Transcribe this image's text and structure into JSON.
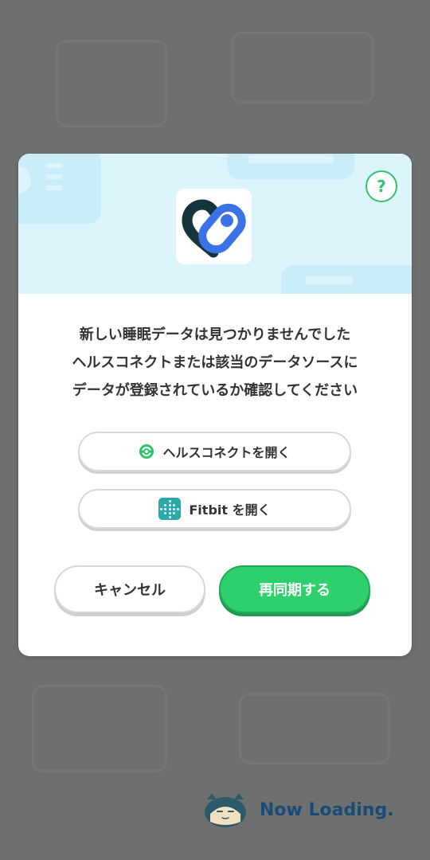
{
  "dialog": {
    "message_lines": [
      "新しい睡眠データは見つかりませんでした",
      "ヘルスコネクトまたは該当のデータソースに",
      "データが登録されているか確認してください"
    ],
    "help_label": "?",
    "open_health_connect_label": "ヘルスコネクトを開く",
    "open_fitbit_label": "Fitbit を開く",
    "cancel_label": "キャンセル",
    "resync_label": "再同期する"
  },
  "loading": {
    "text": "Now Loading."
  },
  "icons": {
    "header_icon": "health-connect-app-icon",
    "help": "question-icon",
    "health_connect_button_icon": "health-connect-icon",
    "fitbit_button_icon": "fitbit-icon",
    "loading_mascot": "snorlax-icon"
  },
  "colors": {
    "overlay": "#6e706f",
    "header_bg": "#dcf4fb",
    "primary_green": "#2ed06e",
    "help_green": "#2ec46b",
    "loading_text": "#1a4a78",
    "fitbit_teal": "#2aa9ac"
  }
}
